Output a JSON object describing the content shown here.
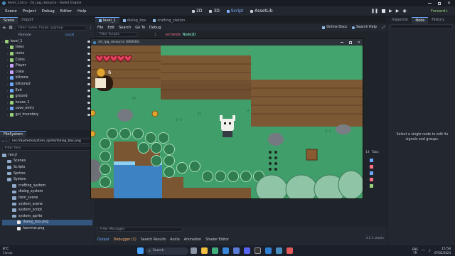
{
  "window": {
    "title": "level_1.tscn - 2d_rpg_resource - Godot Engine"
  },
  "menu": [
    "Scene",
    "Project",
    "Debug",
    "Editor",
    "Help"
  ],
  "workspaces": [
    "2D",
    "3D",
    "Script",
    "AssetLib"
  ],
  "renderer": "Forward+",
  "scene_dock": {
    "tabs": [
      "Scene",
      "Import"
    ],
    "filter_placeholder": "Filter: name, t:type, g:group",
    "remote": "Remote",
    "local": "Local",
    "nodes": [
      {
        "name": "level_1",
        "depth": 0,
        "color": "#9ad07a"
      },
      {
        "name": "trees",
        "depth": 1,
        "color": "#9ad07a"
      },
      {
        "name": "rocks",
        "depth": 1,
        "color": "#9ad07a"
      },
      {
        "name": "Coins",
        "depth": 1,
        "color": "#9ad07a"
      },
      {
        "name": "Player",
        "depth": 1,
        "color": "#c8a2ff"
      },
      {
        "name": "crate",
        "depth": 1,
        "color": "#c8a2ff"
      },
      {
        "name": "killzone",
        "depth": 1,
        "color": "#6fa8ff"
      },
      {
        "name": "killzone2",
        "depth": 1,
        "color": "#6fa8ff"
      },
      {
        "name": "Exit",
        "depth": 1,
        "color": "#6fa8ff"
      },
      {
        "name": "ground",
        "depth": 1,
        "color": "#9ad07a"
      },
      {
        "name": "house_2",
        "depth": 1,
        "color": "#9ad07a"
      },
      {
        "name": "cave_entry",
        "depth": 1,
        "color": "#6fa8ff"
      },
      {
        "name": "gui_inventory",
        "depth": 1,
        "color": "#9ad07a"
      }
    ]
  },
  "filesystem_dock": {
    "title": "FileSystem",
    "path": "res://System/system_sprite/dialog_box.png",
    "filter_placeholder": "Filter Files",
    "items": [
      {
        "name": "res://",
        "depth": 0,
        "type": "folder"
      },
      {
        "name": "Scenes",
        "depth": 1,
        "type": "folder"
      },
      {
        "name": "Scripts",
        "depth": 1,
        "type": "folder"
      },
      {
        "name": "Sprites",
        "depth": 1,
        "type": "folder"
      },
      {
        "name": "System",
        "depth": 1,
        "type": "folder"
      },
      {
        "name": "crafting_system",
        "depth": 2,
        "type": "folder"
      },
      {
        "name": "dialog_system",
        "depth": 2,
        "type": "folder"
      },
      {
        "name": "item_scene",
        "depth": 2,
        "type": "folder"
      },
      {
        "name": "system_scene",
        "depth": 2,
        "type": "folder"
      },
      {
        "name": "system_script",
        "depth": 2,
        "type": "folder"
      },
      {
        "name": "system_sprite",
        "depth": 2,
        "type": "folder"
      },
      {
        "name": "dialog_box.png",
        "depth": 3,
        "type": "file",
        "selected": true
      },
      {
        "name": "hammer.png",
        "depth": 3,
        "type": "file"
      }
    ]
  },
  "script_tabs": [
    "level_1",
    "dialog_box",
    "crafting_station"
  ],
  "script_menu": [
    "File",
    "Edit",
    "Search",
    "Go To",
    "Debug"
  ],
  "script_toolbar": {
    "online_docs": "Online Docs",
    "search_help": "Search Help"
  },
  "filter_scripts_placeholder": "Filter Scripts",
  "code": {
    "line_number": "1",
    "keyword": "extends",
    "class": "Node2D"
  },
  "game_window": {
    "title": "2d_rpg_resource (DEBUG)"
  },
  "game_hud": {
    "hearts": 5,
    "coin_count": "6"
  },
  "inspector": {
    "tabs": [
      "Inspector",
      "Node",
      "History"
    ],
    "message": "Select a single node to edit its signals and groups."
  },
  "bottom_panel": {
    "filter_placeholder": "Filter Messages",
    "tabs": [
      "Output",
      "Debugger (2)",
      "Search Results",
      "Audio",
      "Animation",
      "Shader Editor"
    ],
    "version": "4.2.1.stable"
  },
  "right_toolbox": {
    "line_count": "14",
    "tabs_label": "Tabs"
  },
  "taskbar": {
    "weather_temp": "8°C",
    "weather_text": "Cloudy",
    "search_placeholder": "Search",
    "lang": "ENG",
    "region": "FR",
    "time": "15:58",
    "date": "07/02/2024"
  }
}
